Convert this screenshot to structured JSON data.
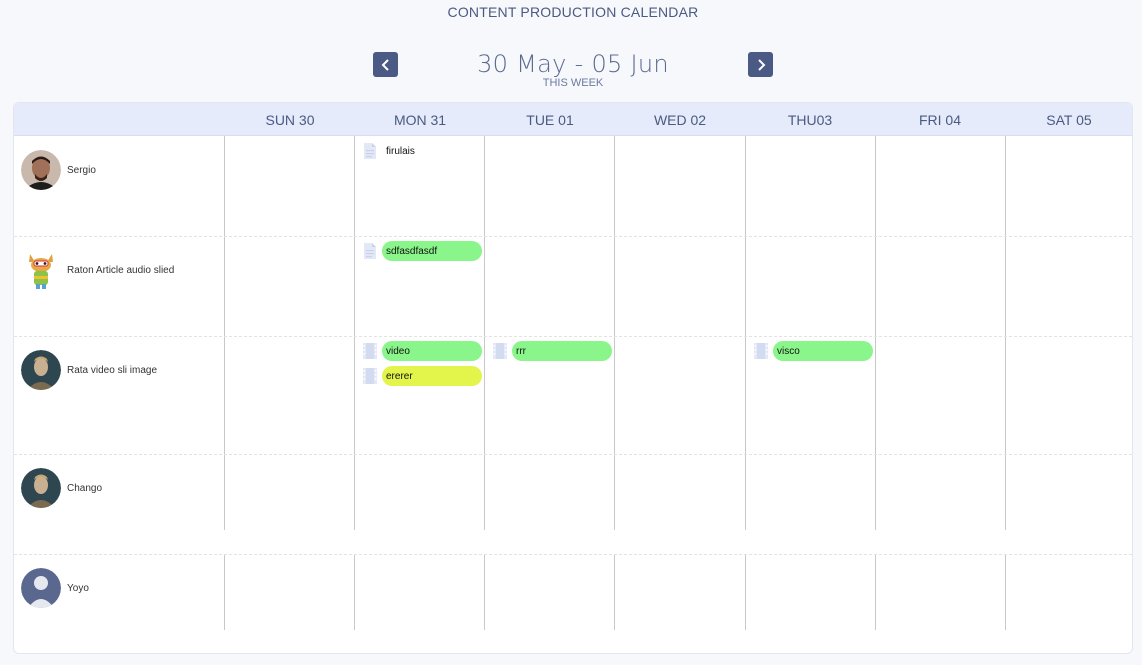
{
  "header": {
    "title": "CONTENT PRODUCTION CALENDAR",
    "range": "30 May - 05 Jun",
    "subtitle": "THIS WEEK"
  },
  "days": [
    {
      "label": "SUN 30"
    },
    {
      "label": "MON 31"
    },
    {
      "label": "TUE  01"
    },
    {
      "label": "WED 02"
    },
    {
      "label": "THU03"
    },
    {
      "label": "FRI 04"
    },
    {
      "label": "SAT 05"
    }
  ],
  "people": [
    {
      "name": "Sergio"
    },
    {
      "name": "Raton Article audio slied"
    },
    {
      "name": "Rata video sli image"
    },
    {
      "name": "Chango"
    },
    {
      "name": "Yoyo"
    }
  ],
  "events": [
    {
      "title": "firulais",
      "type": "document-icon",
      "color": "none"
    },
    {
      "title": "sdfasdfasdf",
      "type": "document-icon",
      "color": "#8af58a"
    },
    {
      "title": "video",
      "type": "film-icon",
      "color": "#8af58a"
    },
    {
      "title": "ererer",
      "type": "film-icon",
      "color": "#e3f54a"
    },
    {
      "title": "rrr",
      "type": "film-icon",
      "color": "#8af58a"
    },
    {
      "title": "visco",
      "type": "film-icon",
      "color": "#8af58a"
    }
  ],
  "colors": {
    "accent": "#4a5a85",
    "header_bg": "#e5ebfb",
    "event_green": "#8af58a",
    "event_yellow": "#e3f54a"
  }
}
